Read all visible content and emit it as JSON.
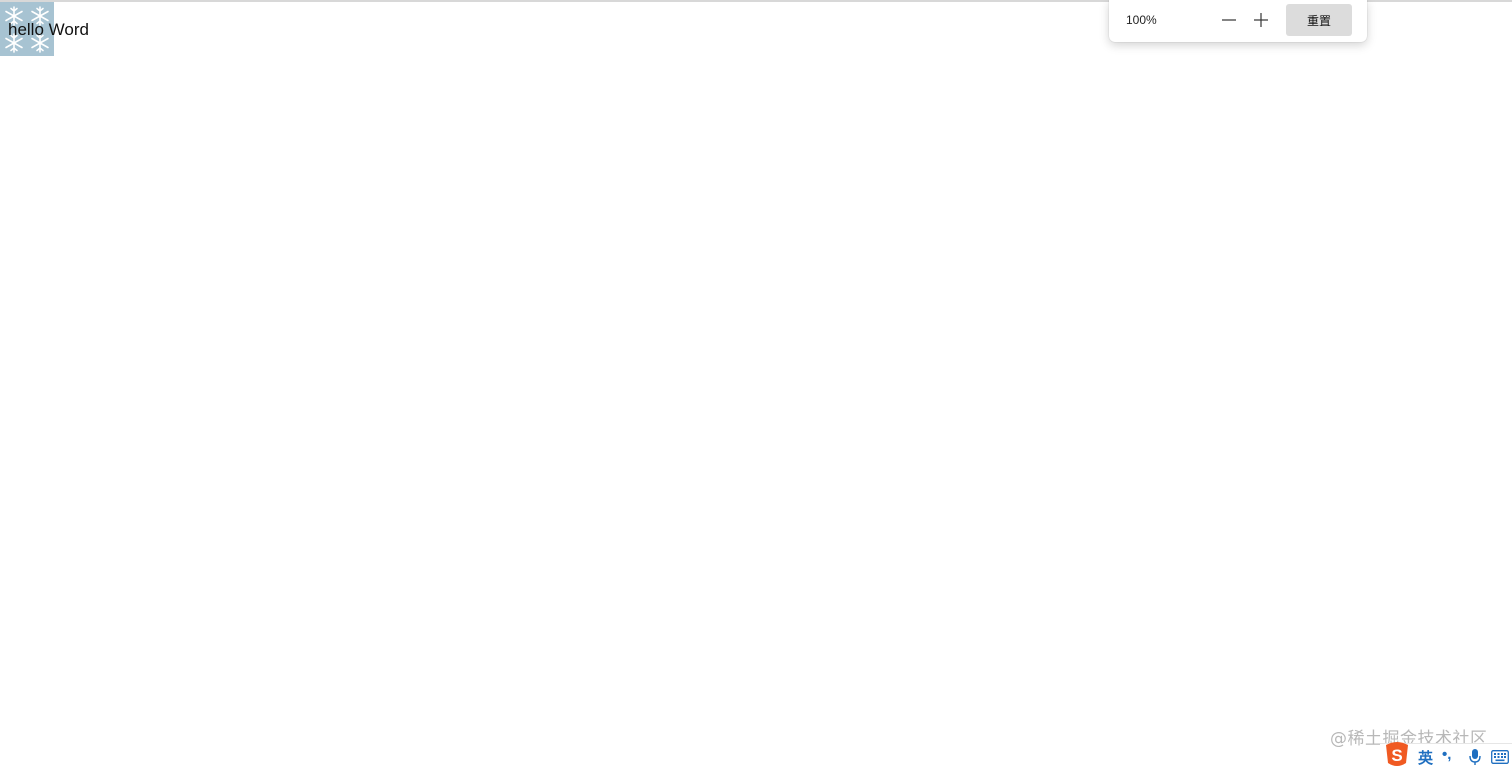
{
  "content": {
    "hello_text": "hello Word"
  },
  "zoom_popup": {
    "zoom_level": "100%",
    "zoom_out_icon": "minus-icon",
    "zoom_in_icon": "plus-icon",
    "reset_label": "重置"
  },
  "watermark": {
    "text": "@稀土掘金技术社区"
  },
  "ime_toolbar": {
    "logo_icon": "sogou-s-icon",
    "language": "英",
    "punctuation": "•,",
    "mic_icon": "microphone-icon",
    "keyboard_icon": "keyboard-icon"
  },
  "colors": {
    "snow_box_bg": "#a7c3d2",
    "ime_accent": "#1f6fc0",
    "ime_logo": "#f05a22",
    "reset_button_bg": "#dcdcdc"
  }
}
